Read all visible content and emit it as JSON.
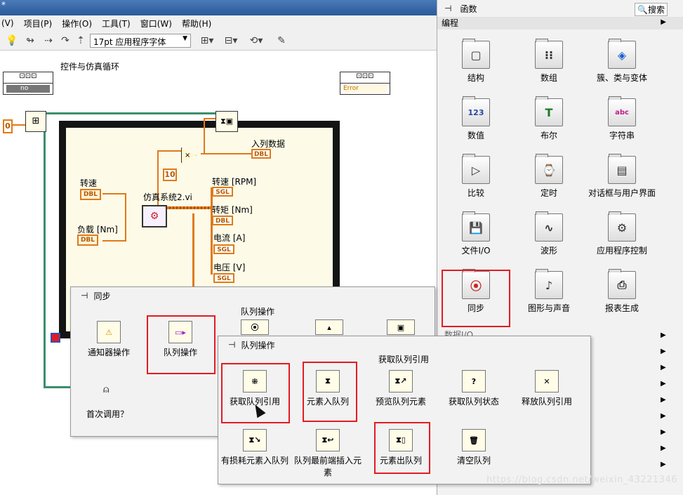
{
  "menubar": [
    "(V)",
    "项目(P)",
    "操作(O)",
    "工具(T)",
    "窗口(W)",
    "帮助(H)"
  ],
  "title_mark": "*",
  "toolbar": {
    "font_select": "17pt 应用程序字体"
  },
  "diagram": {
    "loop_label": "控件与仿真循环",
    "const0": "0",
    "const10": "10",
    "left_tunnel_text": "no",
    "right_tunnel_text": "Error",
    "enqueue_label": "入列数据",
    "speed_ctl": "转速",
    "load_ctl": "负载 [Nm]",
    "sim_vi": "仿真系统2.vi",
    "ind_speed": "转速 [RPM]",
    "ind_torque": "转矩 [Nm]",
    "ind_current": "电流 [A]",
    "ind_voltage": "电压 [V]",
    "dbl": "DBL",
    "sgl": "SGL"
  },
  "palette": {
    "title": "函数",
    "search": "搜索",
    "category": "编程",
    "items": [
      "结构",
      "数组",
      "簇、类与变体",
      "数值",
      "布尔",
      "字符串",
      "比较",
      "定时",
      "对话框与用户界面",
      "文件I/O",
      "波形",
      "应用程序控制",
      "同步",
      "图形与声音",
      "报表生成"
    ],
    "partial": "数据I/O"
  },
  "sync": {
    "title": "同步",
    "group_label": "队列操作",
    "items": [
      "通知器操作",
      "队列操作",
      "首次调用？"
    ]
  },
  "queue": {
    "title": "队列操作",
    "group_label": "获取队列引用",
    "items": [
      "获取队列引用",
      "元素入队列",
      "预览队列元素",
      "获取队列状态",
      "释放队列引用",
      "有损耗元素入队列",
      "队列最前端插入元素",
      "元素出队列",
      "清空队列"
    ]
  },
  "watermark": "https://blog.csdn.net/weixin_43221346",
  "colors": {
    "highlight": "#e31b23",
    "wire_orange": "#e07a16",
    "wire_green": "#3a8f6b"
  }
}
